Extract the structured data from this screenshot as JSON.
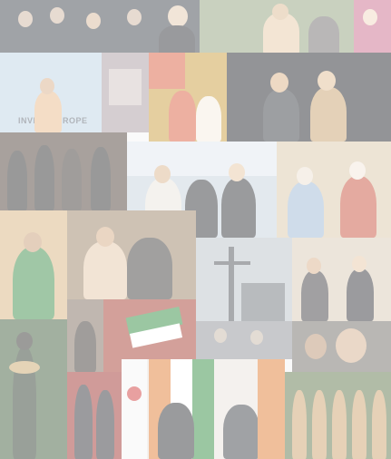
{
  "collage": {
    "description_tiles": 22,
    "banner_sign_text": "INVESTEUROPE"
  },
  "tiles": [
    {
      "name": "tile-crowd-group-photo",
      "bg": "#3a3f48",
      "accent": "#cdb5a0"
    },
    {
      "name": "tile-outdoor-handshake-top",
      "bg": "#8fa07a",
      "accent": "#e6c9a6"
    },
    {
      "name": "tile-banner-speech",
      "bg": "#bcd3e4",
      "accent": "#e8b888"
    },
    {
      "name": "tile-painting-wall",
      "bg": "#a89aa0",
      "accent": "#cfc3c0"
    },
    {
      "name": "tile-bhutan-flag-greeting",
      "bg": "#c99b3a",
      "accent": "#d95a3b"
    },
    {
      "name": "tile-dark-handshake",
      "bg": "#1f2126",
      "accent": "#d9b084"
    },
    {
      "name": "tile-suits-row",
      "bg": "#4a3c32",
      "accent": "#2b2b2b"
    },
    {
      "name": "tile-airport-handshake",
      "bg": "#c5d1db",
      "accent": "#2d2f34"
    },
    {
      "name": "tile-queen-handshake",
      "bg": "#d9c7a8",
      "accent": "#c64e3a"
    },
    {
      "name": "tile-garland-speech",
      "bg": "#d8b27e",
      "accent": "#3a8a45"
    },
    {
      "name": "tile-hug-greeting",
      "bg": "#9a7f63",
      "accent": "#e3c7a8"
    },
    {
      "name": "tile-warship-mast",
      "bg": "#b9c0c7",
      "accent": "#4a4f55"
    },
    {
      "name": "tile-seated-meeting",
      "bg": "#d7c9b5",
      "accent": "#3b3a3e"
    },
    {
      "name": "tile-house-visit",
      "bg": "#7b6a5a",
      "accent": "#ffffff"
    },
    {
      "name": "tile-cricket-jersey",
      "bg": "#a33a2c",
      "accent": "#2e8b3e"
    },
    {
      "name": "tile-grey-crowd",
      "bg": "#8d8f94",
      "accent": "#c4b6a6"
    },
    {
      "name": "tile-selfie-closeup",
      "bg": "#6e6a62",
      "accent": "#d3ad8c"
    },
    {
      "name": "tile-statue-garland",
      "bg": "#3d5a3a",
      "accent": "#c9a66a"
    },
    {
      "name": "tile-red-carpet-walk",
      "bg": "#9e2f2b",
      "accent": "#2f2f35"
    },
    {
      "name": "tile-korea-india-flags",
      "bg": "#e8e2dc",
      "accent": "#e07a2f"
    },
    {
      "name": "tile-guard-of-honour",
      "bg": "#5c7347",
      "accent": "#caa06a"
    },
    {
      "name": "tile-flowers-crowd",
      "bg": "#c96a8a",
      "accent": "#f0d8c0"
    }
  ]
}
